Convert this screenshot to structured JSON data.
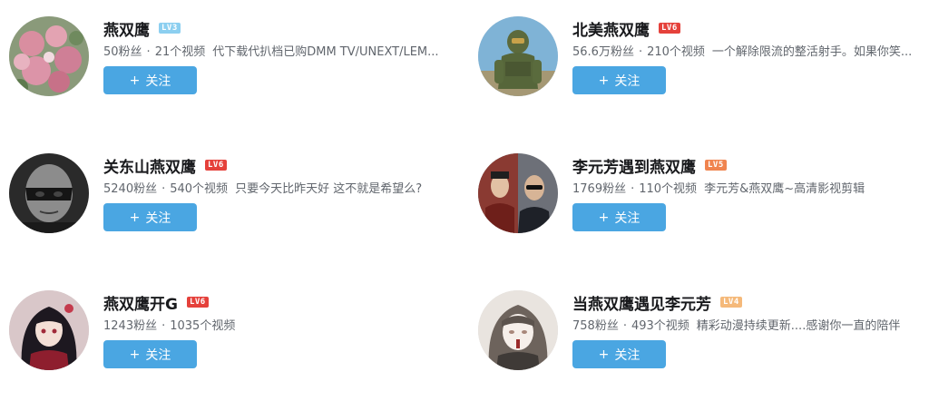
{
  "users": [
    {
      "name": "燕双鹰",
      "level": "LV3",
      "level_color": "#8ccff0",
      "fans": "50粉丝",
      "videos": "21个视频",
      "sign": "代下载代扒档已购DMM TV/UNEXT/LEM...",
      "avatar_icon": "pink-flowers-avatar",
      "follow_label": "关注"
    },
    {
      "name": "北美燕双鹰",
      "level": "LV6",
      "level_color": "#e5413b",
      "fans": "56.6万粉丝",
      "videos": "210个视频",
      "sign": "一个解除限流的整活射手。如果你笑...",
      "avatar_icon": "armored-soldier-avatar",
      "follow_label": "关注"
    },
    {
      "name": "关东山燕双鹰",
      "level": "LV6",
      "level_color": "#e5413b",
      "fans": "5240粉丝",
      "videos": "540个视频",
      "sign": "只要今天比昨天好 这不就是希望么?",
      "avatar_icon": "masked-man-avatar",
      "follow_label": "关注"
    },
    {
      "name": "李元芳遇到燕双鹰",
      "level": "LV5",
      "level_color": "#f0844f",
      "fans": "1769粉丝",
      "videos": "110个视频",
      "sign": "李元芳&燕双鹰~高清影视剪辑",
      "avatar_icon": "two-actors-avatar",
      "follow_label": "关注"
    },
    {
      "name": "燕双鹰开G",
      "level": "LV6",
      "level_color": "#e5413b",
      "fans": "1243粉丝",
      "videos": "1035个视频",
      "sign": "",
      "avatar_icon": "anime-girl-avatar",
      "follow_label": "关注"
    },
    {
      "name": "当燕双鹰遇见李元芳",
      "level": "LV4",
      "level_color": "#f5b97a",
      "fans": "758粉丝",
      "videos": "493个视频",
      "sign": "精彩动漫持续更新....感谢你一直的陪伴",
      "avatar_icon": "sketch-girl-avatar",
      "follow_label": "关注"
    }
  ],
  "meta_separator": "·",
  "follow_plus": "+"
}
